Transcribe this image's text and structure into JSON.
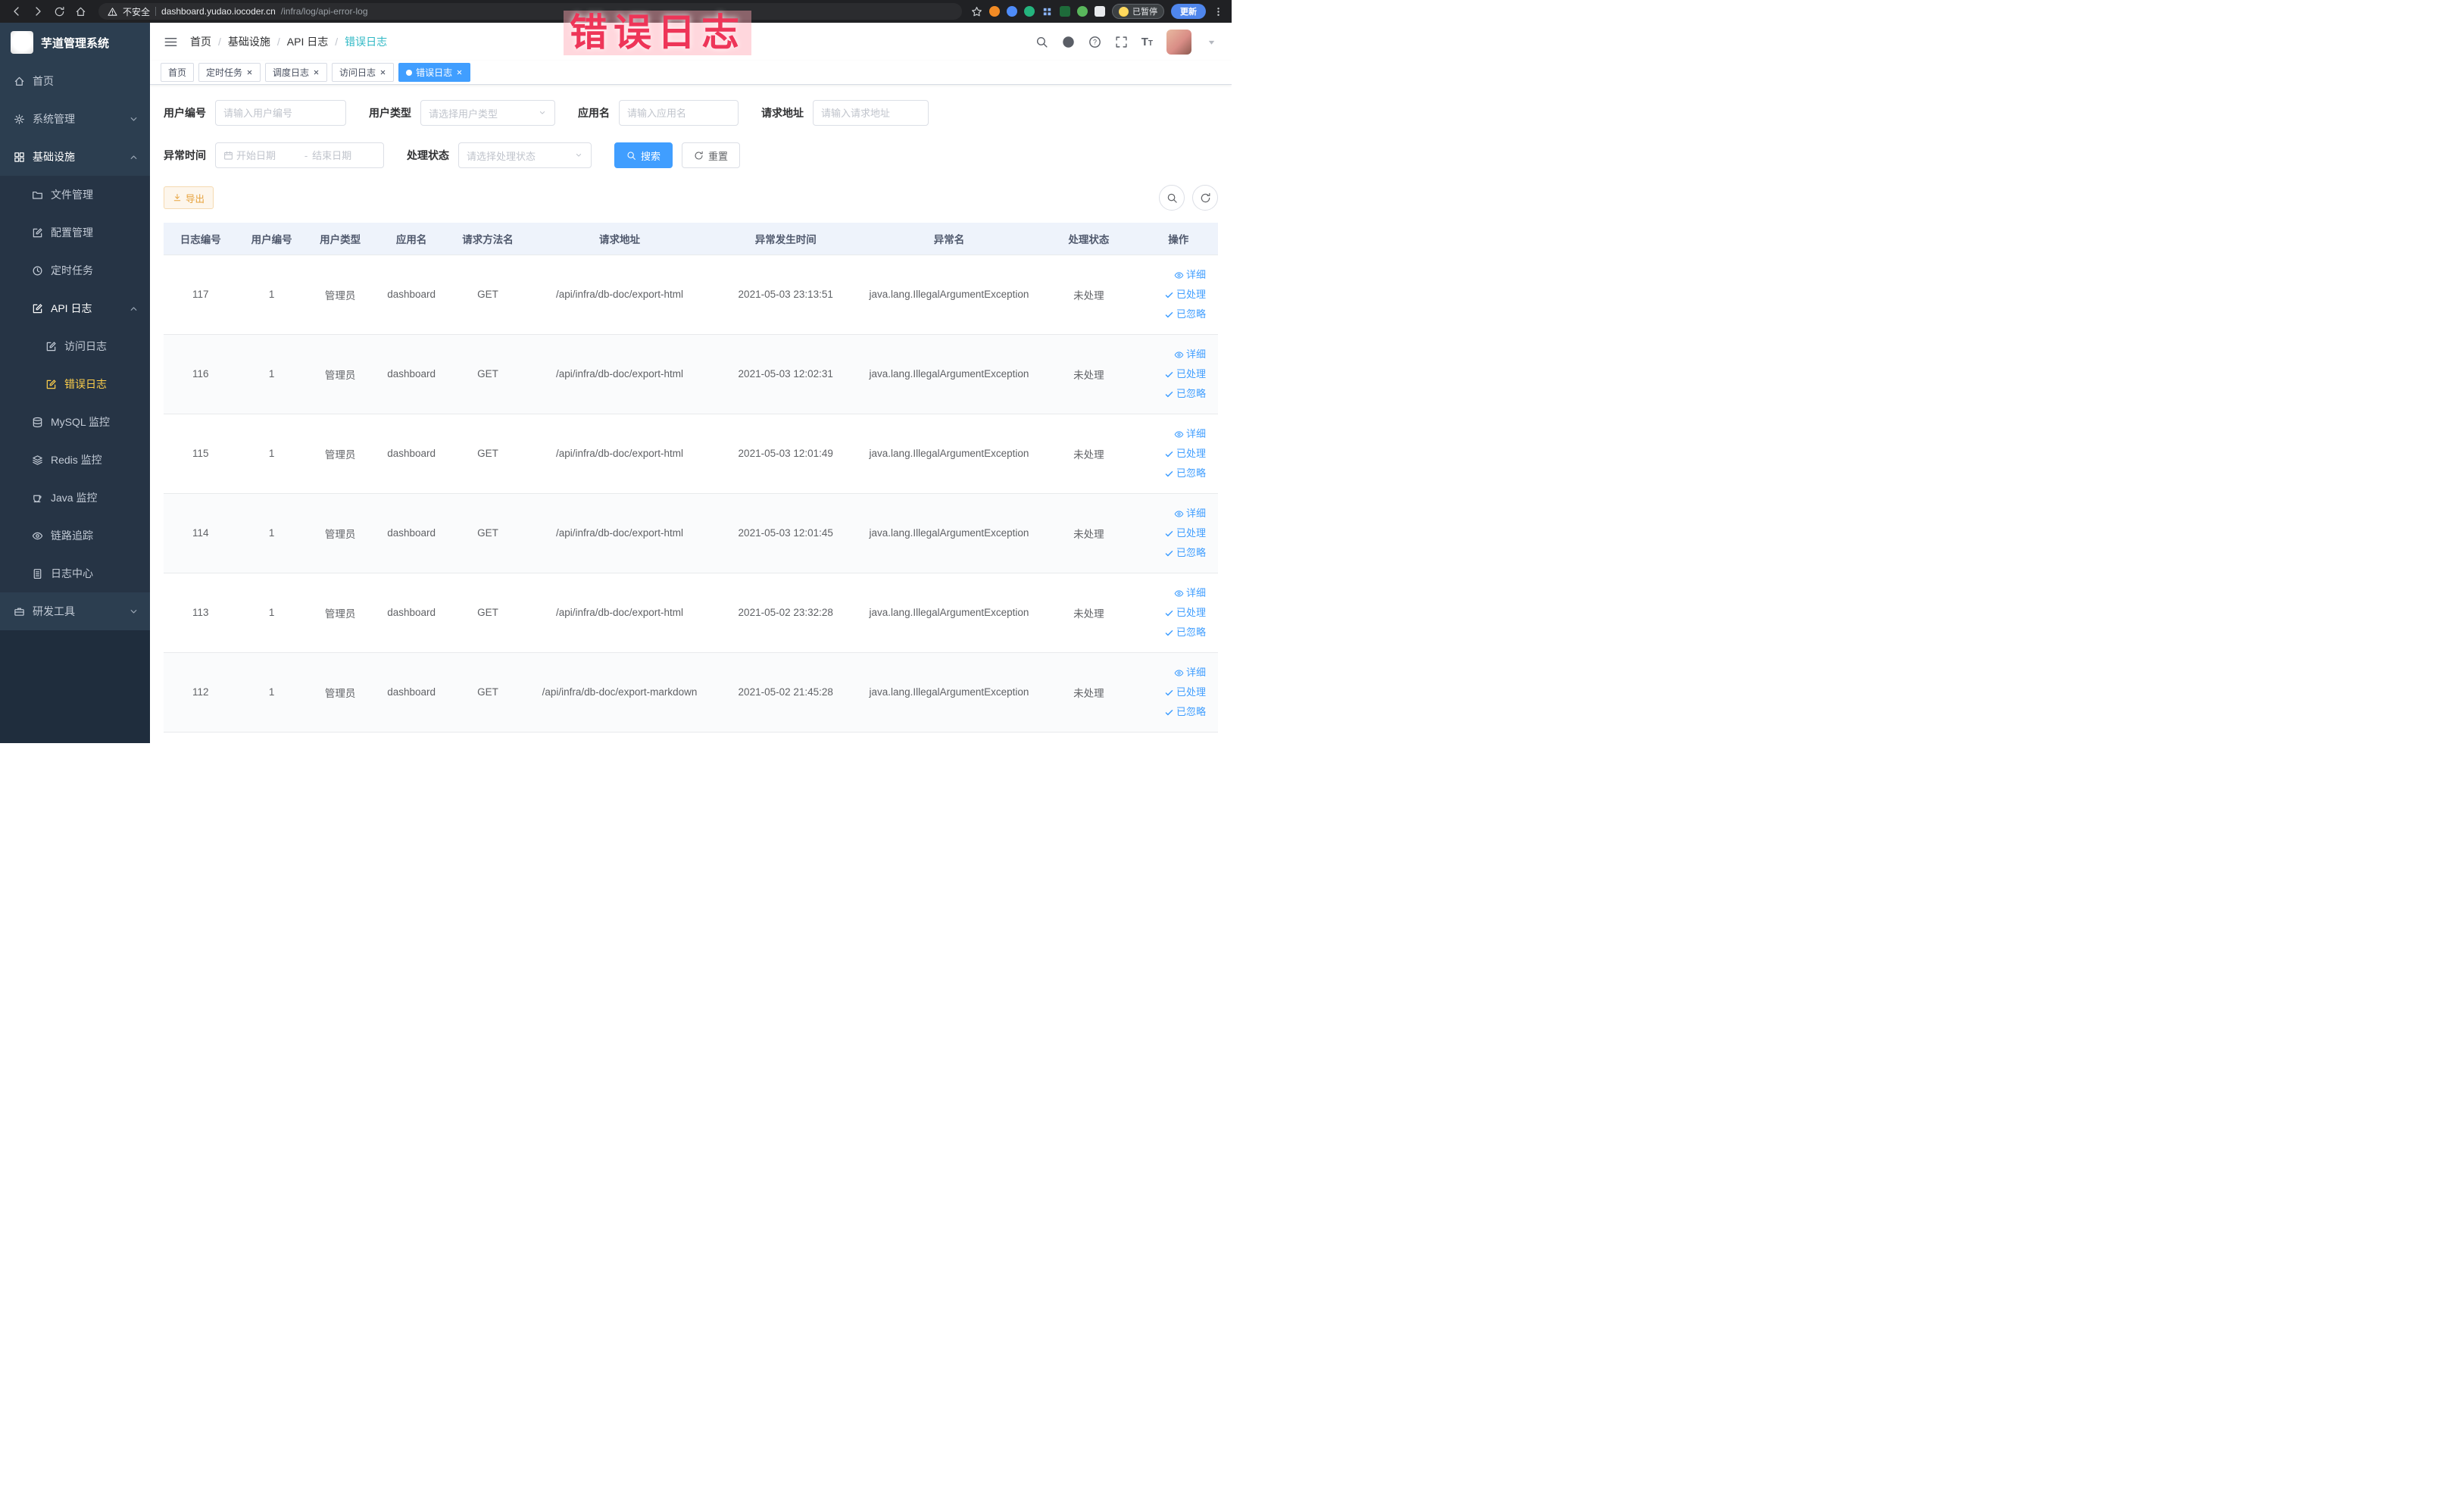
{
  "browser": {
    "security_label": "不安全",
    "url_domain": "dashboard.yudao.iocoder.cn",
    "url_path": "/infra/log/api-error-log",
    "paused_label": "已暂停",
    "update_label": "更新"
  },
  "annotation": {
    "text": "错误日志"
  },
  "sidebar": {
    "title": "芋道管理系统",
    "home": "首页",
    "system": "系统管理",
    "infra": "基础设施",
    "file": "文件管理",
    "config": "配置管理",
    "job": "定时任务",
    "apilog": "API 日志",
    "accesslog": "访问日志",
    "errorlog": "错误日志",
    "mysql": "MySQL 监控",
    "redis": "Redis 监控",
    "java": "Java 监控",
    "trace": "链路追踪",
    "logcenter": "日志中心",
    "devtools": "研发工具"
  },
  "breadcrumb": {
    "items": [
      "首页",
      "基础设施",
      "API 日志",
      "错误日志"
    ]
  },
  "tabs": [
    {
      "label": "首页"
    },
    {
      "label": "定时任务"
    },
    {
      "label": "调度日志"
    },
    {
      "label": "访问日志"
    },
    {
      "label": "错误日志"
    }
  ],
  "filters": {
    "user_id_label": "用户编号",
    "user_id_placeholder": "请输入用户编号",
    "user_type_label": "用户类型",
    "user_type_placeholder": "请选择用户类型",
    "app_name_label": "应用名",
    "app_name_placeholder": "请输入应用名",
    "request_url_label": "请求地址",
    "request_url_placeholder": "请输入请求地址",
    "exception_time_label": "异常时间",
    "start_date_placeholder": "开始日期",
    "range_separator": "-",
    "end_date_placeholder": "结束日期",
    "process_status_label": "处理状态",
    "process_status_placeholder": "请选择处理状态",
    "search_button": "搜索",
    "reset_button": "重置"
  },
  "toolbar": {
    "export_button": "导出"
  },
  "table": {
    "columns": [
      "日志编号",
      "用户编号",
      "用户类型",
      "应用名",
      "请求方法名",
      "请求地址",
      "异常发生时间",
      "异常名",
      "处理状态",
      "操作"
    ],
    "rows": [
      [
        "117",
        "1",
        "管理员",
        "dashboard",
        "GET",
        "/api/infra/db-doc/export-html",
        "2021-05-03 23:13:51",
        "java.lang.IllegalArgumentException",
        "未处理"
      ],
      [
        "116",
        "1",
        "管理员",
        "dashboard",
        "GET",
        "/api/infra/db-doc/export-html",
        "2021-05-03 12:02:31",
        "java.lang.IllegalArgumentException",
        "未处理"
      ],
      [
        "115",
        "1",
        "管理员",
        "dashboard",
        "GET",
        "/api/infra/db-doc/export-html",
        "2021-05-03 12:01:49",
        "java.lang.IllegalArgumentException",
        "未处理"
      ],
      [
        "114",
        "1",
        "管理员",
        "dashboard",
        "GET",
        "/api/infra/db-doc/export-html",
        "2021-05-03 12:01:45",
        "java.lang.IllegalArgumentException",
        "未处理"
      ],
      [
        "113",
        "1",
        "管理员",
        "dashboard",
        "GET",
        "/api/infra/db-doc/export-html",
        "2021-05-02 23:32:28",
        "java.lang.IllegalArgumentException",
        "未处理"
      ],
      [
        "112",
        "1",
        "管理员",
        "dashboard",
        "GET",
        "/api/infra/db-doc/export-markdown",
        "2021-05-02 21:45:28",
        "java.lang.IllegalArgumentException",
        "未处理"
      ]
    ],
    "actions": {
      "detail": "详细",
      "processed": "已处理",
      "ignored": "已忽略"
    }
  },
  "colors": {
    "accent": "#409eff",
    "sidebar_bg": "#2c3e50",
    "sidebar_active": "#ffd04b",
    "warning": "#e6a23c",
    "annotation_red": "#ee3558",
    "breadcrumb_current": "#2fb8c5",
    "table_header_bg": "#eef3fb"
  }
}
